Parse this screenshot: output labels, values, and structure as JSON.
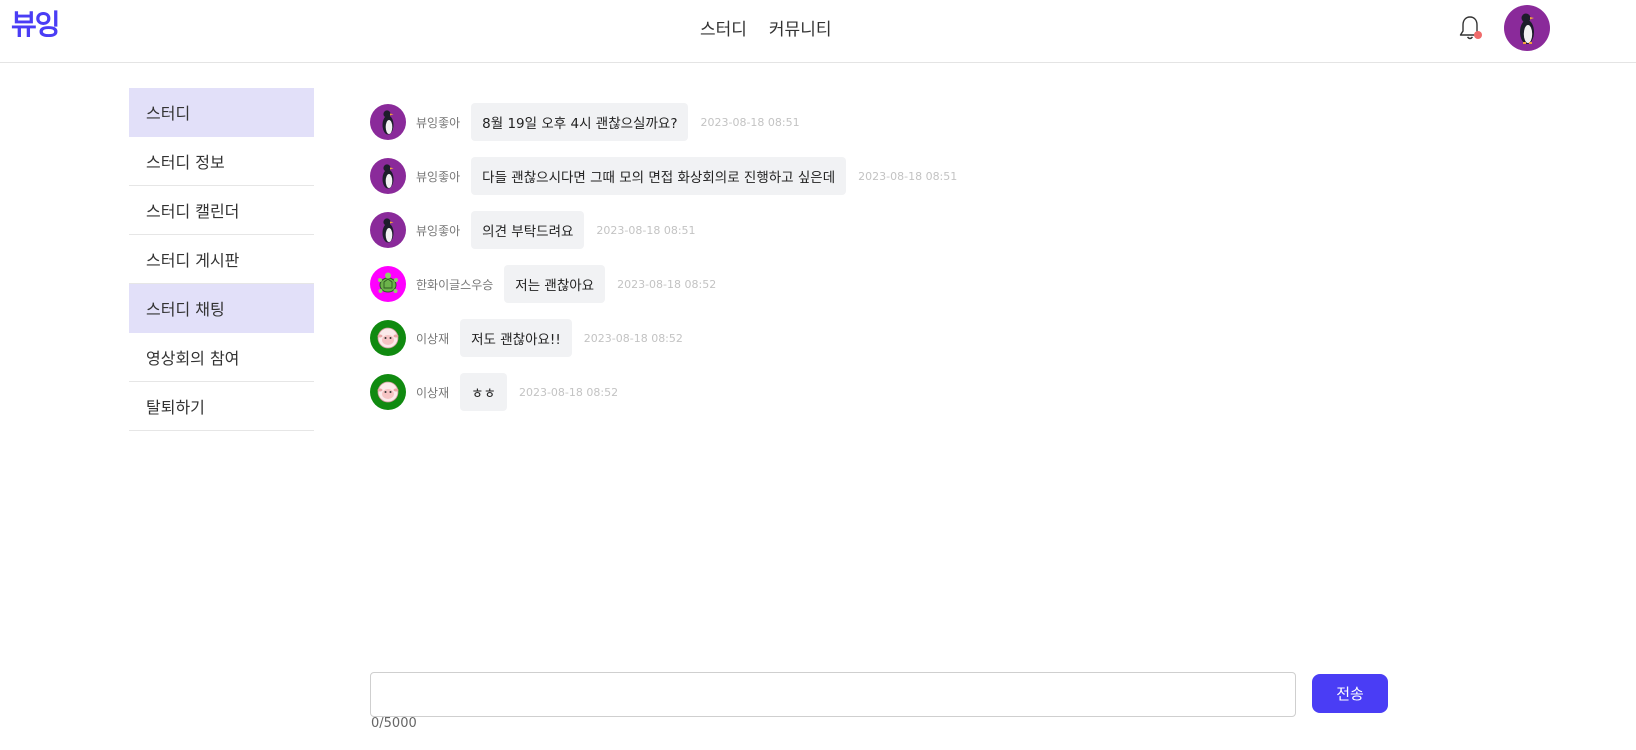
{
  "header": {
    "logo": "뷰잉",
    "nav": [
      "스터디",
      "커뮤니티"
    ],
    "bell_icon": "bell-icon",
    "notification_color": "#f06b6b",
    "avatar_icon": "penguin-avatar-icon"
  },
  "sidebar": {
    "items": [
      {
        "label": "스터디",
        "active": true
      },
      {
        "label": "스터디 정보",
        "active": false
      },
      {
        "label": "스터디 캘린더",
        "active": false
      },
      {
        "label": "스터디 게시판",
        "active": false
      },
      {
        "label": "스터디 채팅",
        "active": true
      },
      {
        "label": "영상회의 참여",
        "active": false
      },
      {
        "label": "탈퇴하기",
        "active": false
      }
    ],
    "active_color": "#e2e0f9"
  },
  "messages": [
    {
      "sender": "뷰잉좋아",
      "text": "8월 19일 오후 4시 괜찮으실까요?",
      "time": "2023-08-18 08:51",
      "avatar": "penguin-icon",
      "avatar_color": "#8a2a9a"
    },
    {
      "sender": "뷰잉좋아",
      "text": "다들 괜찮으시다면 그때 모의 면접 화상회의로 진행하고 싶은데",
      "time": "2023-08-18 08:51",
      "avatar": "penguin-icon",
      "avatar_color": "#8a2a9a"
    },
    {
      "sender": "뷰잉좋아",
      "text": "의견 부탁드려요",
      "time": "2023-08-18 08:51",
      "avatar": "penguin-icon",
      "avatar_color": "#8a2a9a"
    },
    {
      "sender": "한화이글스우승",
      "text": "저는 괜찮아요",
      "time": "2023-08-18 08:52",
      "avatar": "turtle-icon",
      "avatar_color": "#ff00ff"
    },
    {
      "sender": "이상재",
      "text": "저도 괜찮아요!!",
      "time": "2023-08-18 08:52",
      "avatar": "sheep-icon",
      "avatar_color": "#108a10"
    },
    {
      "sender": "이상재",
      "text": "ㅎㅎ",
      "time": "2023-08-18 08:52",
      "avatar": "sheep-icon",
      "avatar_color": "#108a10"
    }
  ],
  "composer": {
    "value": "",
    "placeholder": "",
    "send_label": "전송",
    "counter": "0/5000",
    "accent": "#4a3df5"
  }
}
